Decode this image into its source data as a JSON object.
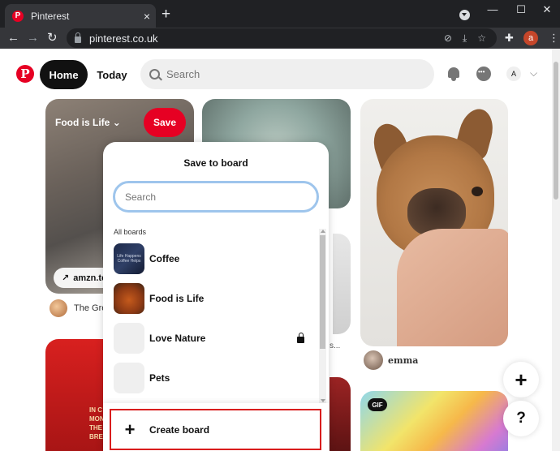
{
  "browser": {
    "tab_title": "Pinterest",
    "tab_close": "×",
    "new_tab": "+",
    "url": "pinterest.co.uk",
    "profile_initial": "a",
    "window_controls": {
      "minimize": "—",
      "maximize": "☐",
      "close": "✕"
    }
  },
  "header": {
    "logo": "P",
    "home": "Home",
    "today": "Today",
    "search_placeholder": "Search",
    "account_initial": "A"
  },
  "pins": {
    "pin1": {
      "board_label": "Food is Life",
      "save_label": "Save",
      "link": "amzn.to",
      "caption": "The Gre"
    },
    "pin3_caption": "s...",
    "pin4_text": "IN C\nMONDAY\nTHE\nBREA",
    "pin6_user": "emma",
    "pin7_badge": "GIF"
  },
  "popup": {
    "title": "Save to board",
    "search_placeholder": "Search",
    "section_label": "All boards",
    "boards": [
      {
        "name": "Coffee",
        "thumb_text": "Life Happens Coffee Helps",
        "secret": false
      },
      {
        "name": "Food is Life",
        "secret": false
      },
      {
        "name": "Love Nature",
        "secret": true
      },
      {
        "name": "Pets",
        "secret": false
      }
    ],
    "create_label": "Create board"
  },
  "fab": {
    "add": "+",
    "help": "?"
  },
  "colors": {
    "brand_red": "#e60023",
    "highlight_border": "#d91d1d",
    "search_focus_ring": "#9ec5ec"
  }
}
